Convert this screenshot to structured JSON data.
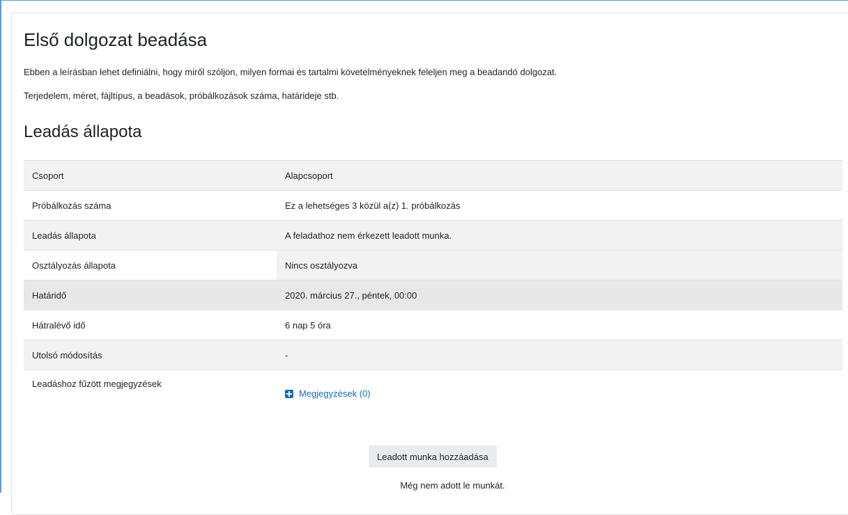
{
  "page": {
    "title": "Első dolgozat beadása",
    "intro_1": "Ebben a leírásban lehet definiálni, hogy miről szóljon, milyen formai és tartalmi követelményeknek feleljen meg a beadandó dolgozat.",
    "intro_2": "Terjedelem, méret, fájltípus, a beadások, próbálkozások száma, határideje stb."
  },
  "status": {
    "heading": "Leadás állapota",
    "rows": [
      {
        "label": "Csoport",
        "value": "Alapcsoport"
      },
      {
        "label": "Próbálkozás száma",
        "value": "Ez a lehetséges 3 közül a(z) 1. próbálkozás"
      },
      {
        "label": "Leadás állapota",
        "value": "A feladathoz nem érkezett leadott munka."
      },
      {
        "label": "Osztályozás állapota",
        "value": "Nincs osztályozva"
      },
      {
        "label": "Határidő",
        "value": "2020. március 27., péntek, 00:00"
      },
      {
        "label": "Hátralévő idő",
        "value": "6 nap 5 óra"
      },
      {
        "label": "Utolsó módosítás",
        "value": "-"
      },
      {
        "label": "Leadáshoz fűzött megjegyzések",
        "link": "Megjegyzések (0)"
      }
    ]
  },
  "actions": {
    "add_submission": "Leadott munka hozzáadása",
    "no_submission_note": "Még nem adott le munkát."
  },
  "colors": {
    "link": "#0f6cbf",
    "frame": "#5b9bd5"
  }
}
